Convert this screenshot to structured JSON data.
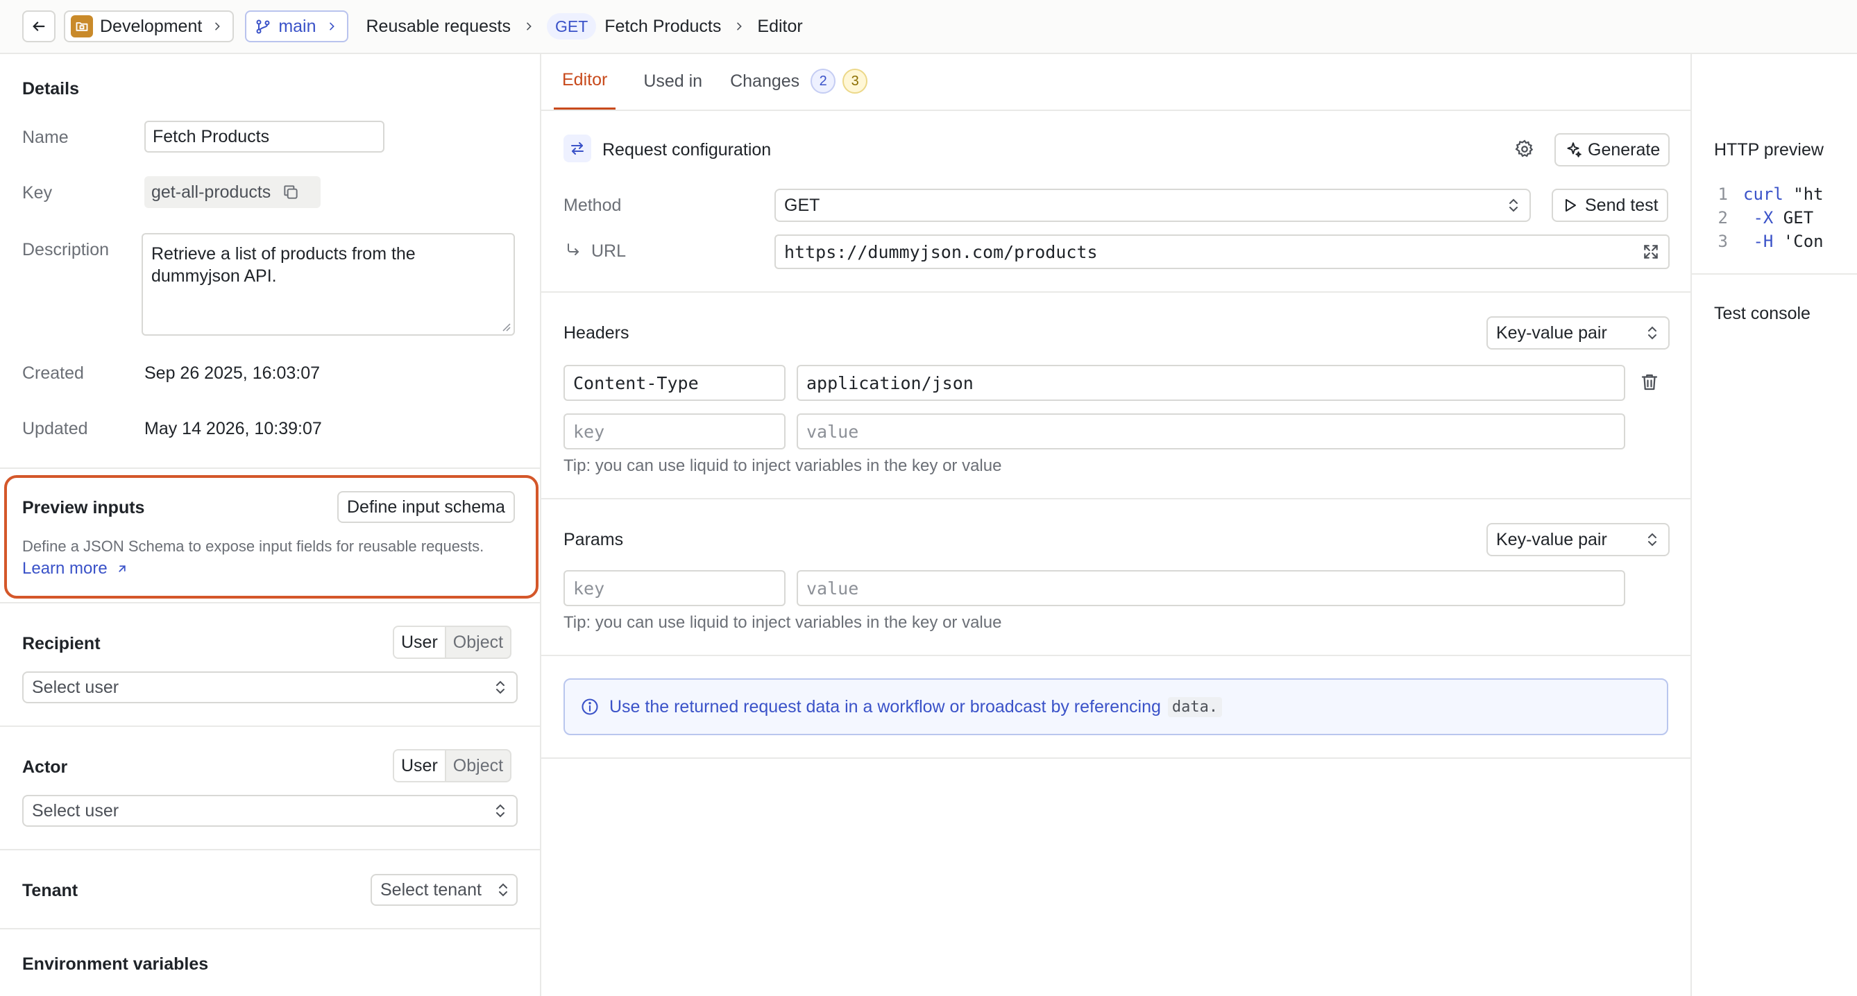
{
  "breadcrumb": {
    "environment": "Development",
    "branch": "main",
    "section": "Reusable requests",
    "method": "GET",
    "request_name": "Fetch Products",
    "page": "Editor"
  },
  "details": {
    "title": "Details",
    "name_label": "Name",
    "name_value": "Fetch Products",
    "key_label": "Key",
    "key_value": "get-all-products",
    "description_label": "Description",
    "description_value": "Retrieve a list of products from the\ndummyjson API.",
    "created_label": "Created",
    "created_value": "Sep 26 2025, 16:03:07",
    "updated_label": "Updated",
    "updated_value": "May 14 2026, 10:39:07"
  },
  "preview_inputs": {
    "title": "Preview inputs",
    "define_button": "Define input schema",
    "help": "Define a JSON Schema to expose input fields for reusable requests.",
    "learn_more": "Learn more"
  },
  "recipient": {
    "title": "Recipient",
    "opt_user": "User",
    "opt_object": "Object",
    "select": "Select user"
  },
  "actor": {
    "title": "Actor",
    "opt_user": "User",
    "opt_object": "Object",
    "select": "Select user"
  },
  "tenant": {
    "title": "Tenant",
    "select": "Select tenant"
  },
  "env_vars": {
    "title": "Environment variables"
  },
  "tabs": {
    "editor": "Editor",
    "used_in": "Used in",
    "changes": "Changes",
    "changes_badge_1": "2",
    "changes_badge_2": "3"
  },
  "request_config": {
    "title": "Request configuration",
    "generate": "Generate",
    "method_label": "Method",
    "method_value": "GET",
    "send_test": "Send test",
    "url_label": "URL",
    "url_value": "https://dummyjson.com/products"
  },
  "headers": {
    "title": "Headers",
    "mode": "Key-value pair",
    "row1_key": "Content-Type",
    "row1_value": "application/json",
    "key_placeholder": "key",
    "value_placeholder": "value",
    "tip": "Tip: you can use liquid to inject variables in the key or value"
  },
  "params": {
    "title": "Params",
    "mode": "Key-value pair",
    "key_placeholder": "key",
    "value_placeholder": "value",
    "tip": "Tip: you can use liquid to inject variables in the key or value"
  },
  "info": {
    "text": "Use the returned request data in a workflow or broadcast by referencing",
    "code": "data."
  },
  "http_preview": {
    "title": "HTTP preview",
    "lines": [
      {
        "n": "1",
        "kw": "curl",
        "rest": " \"ht"
      },
      {
        "n": "2",
        "kw": " -X",
        "rest": " GET"
      },
      {
        "n": "3",
        "kw": " -H",
        "rest": " 'Con"
      }
    ]
  },
  "test_console": {
    "title": "Test console"
  },
  "colors": {
    "accent": "#c84a1c",
    "link": "#3a52c8",
    "highlight_border": "#d4572a",
    "env_icon": "#c98a2a"
  }
}
